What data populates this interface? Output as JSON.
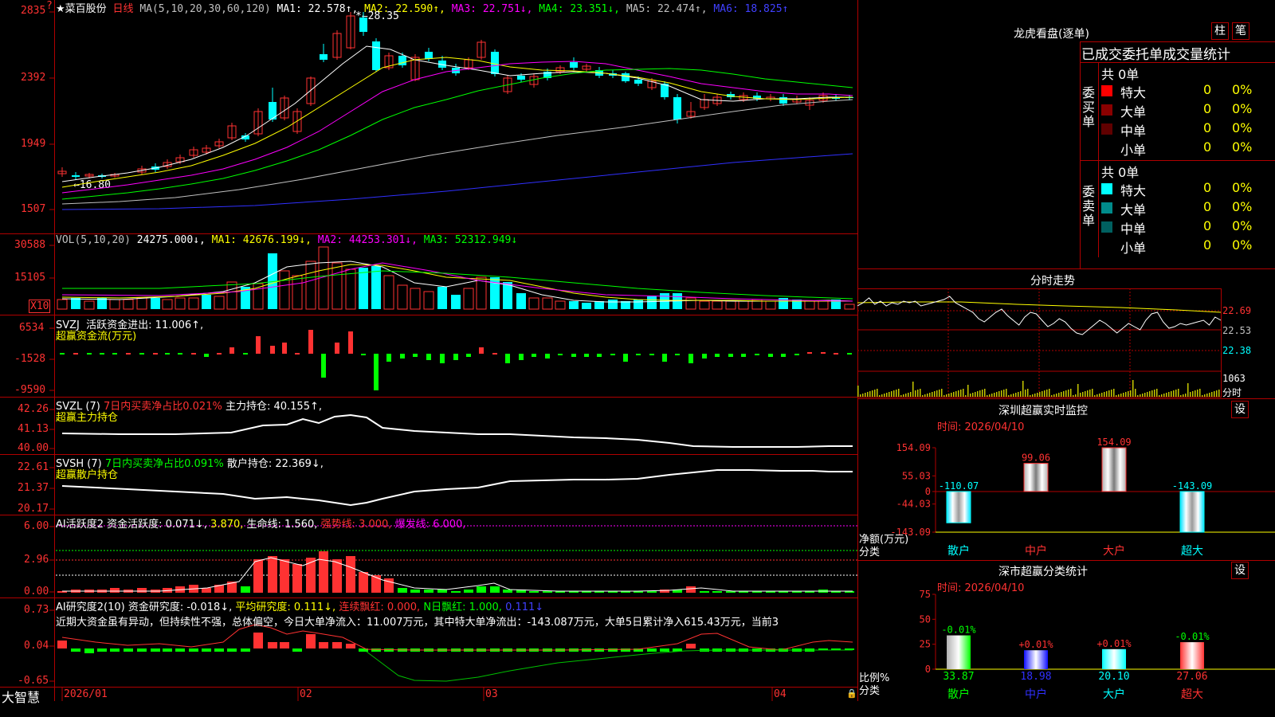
{
  "colors": {
    "up": "#ff3232",
    "down": "#00ffff",
    "ma1": "#ffffff",
    "ma2": "#ffff00",
    "ma3": "#ff00ff",
    "ma4": "#00ff00",
    "ma5": "#c0c0c0",
    "ma6": "#3030ff",
    "grid": "#b00000"
  },
  "header": {
    "stock_name": "★菜百股份",
    "period": "日线",
    "ma_title": "MA(5,10,20,30,60,120)",
    "ma1": "MA1: 22.578↑,",
    "ma2": "MA2: 22.590↑,",
    "ma3": "MA3: 22.751↓,",
    "ma4": "MA4: 23.351↓,",
    "ma5": "MA5: 22.474↑,",
    "ma6": "MA6: 18.825↑"
  },
  "price_axis": [
    "2835",
    "2392",
    "1949",
    "1507"
  ],
  "price_annotations": {
    "high": "28.35",
    "low": "16.80"
  },
  "vol": {
    "title": "VOL(5,10,20)",
    "value": "24275.000↓,",
    "ma1": "MA1: 42676.199↓,",
    "ma2": "MA2: 44253.301↓,",
    "ma3": "MA3: 52312.949↓",
    "axis": [
      "30588",
      "15105"
    ],
    "unit": "X10"
  },
  "svzj": {
    "title": "SVZJ",
    "line1": "活跃资金进出: 11.006↑,",
    "line2": "超赢资金流(万元)",
    "axis": [
      "6534",
      "-1528",
      "-9590"
    ]
  },
  "svzl": {
    "title": "SVZL (7)",
    "ratio": "7日内买卖净占比0.021%",
    "hold": "主力持仓: 40.155↑,",
    "line2": "超赢主力持仓",
    "axis": [
      "42.26",
      "41.13",
      "40.00"
    ]
  },
  "svsh": {
    "title": "SVSH (7)",
    "ratio": "7日内买卖净占比0.091%",
    "hold": "散户持仓: 22.369↓,",
    "line2": "超赢散户持仓",
    "axis": [
      "22.61",
      "21.37",
      "20.17"
    ]
  },
  "ai_active": {
    "title": "AI活跃度2",
    "v1": "资金活跃度: 0.071↓,",
    "v2": "3.870,",
    "v3": "生命线: 1.560,",
    "v4": "强势线: 3.000,",
    "v5": "爆发线: 6.000,",
    "axis": [
      "6.00",
      "2.96",
      "0.00"
    ]
  },
  "ai_research": {
    "title": "AI研究度2(10)",
    "v1": "资金研究度: -0.018↓,",
    "v2": "平均研究度: 0.111↓,",
    "v3": "连续飘红: 0.000,",
    "v4": "N日飘红: 1.000,",
    "v5": "0.111↓",
    "comment": "近期大资金虽有异动，但持续性不强，总体偏空，今日大单净流入：11.007万元，其中特大单净流出：-143.087万元，大单5日累计净入615.43万元，当前3",
    "axis": [
      "0.73",
      "0.04",
      "-0.65"
    ]
  },
  "bottom": {
    "brand": "大智慧",
    "dates": [
      "2026/01",
      "02",
      "03",
      "04"
    ]
  },
  "dragon_tiger": {
    "title": "龙虎看盘(逐单)",
    "btn1": "柱",
    "btn2": "笔",
    "subtitle": "已成交委托单成交量统计",
    "buy_label": "委买单",
    "sell_label": "委卖单",
    "buy_total": "共 0单",
    "sell_total": "共 0单",
    "buy_rows": [
      {
        "name": "特大",
        "count": "0",
        "pct": "0%"
      },
      {
        "name": "大单",
        "count": "0",
        "pct": "0%"
      },
      {
        "name": "中单",
        "count": "0",
        "pct": "0%"
      },
      {
        "name": "小单",
        "count": "0",
        "pct": "0%"
      }
    ],
    "sell_rows": [
      {
        "name": "特大",
        "count": "0",
        "pct": "0%"
      },
      {
        "name": "大单",
        "count": "0",
        "pct": "0%"
      },
      {
        "name": "中单",
        "count": "0",
        "pct": "0%"
      },
      {
        "name": "小单",
        "count": "0",
        "pct": "0%"
      }
    ]
  },
  "intraday": {
    "title": "分时走势",
    "axis": [
      "22.69",
      "22.53",
      "22.38"
    ],
    "vol_value": "1063",
    "vol_unit": "分时"
  },
  "sz_monitor": {
    "title": "深圳超赢实时监控",
    "btn": "设",
    "time": "时间: 2026/04/10",
    "axis": [
      "154.09",
      "55.03",
      "0",
      "-44.03",
      "-143.09"
    ],
    "ylabel": "净额(万元)",
    "xlabel": "分类",
    "bars": [
      {
        "name": "散户",
        "value": -110.07,
        "label": "-110.07"
      },
      {
        "name": "中户",
        "value": 99.06,
        "label": "99.06"
      },
      {
        "name": "大户",
        "value": 154.09,
        "label": "154.09"
      },
      {
        "name": "超大",
        "value": -143.09,
        "label": "-143.09"
      }
    ]
  },
  "sz_class": {
    "title": "深市超赢分类统计",
    "btn": "设",
    "time": "时间: 2026/04/10",
    "axis": [
      "75",
      "50",
      "25",
      "0"
    ],
    "ylabel": "比例%",
    "xlabel": "分类",
    "bars": [
      {
        "name": "散户",
        "value": 33.87,
        "label": "33.87",
        "delta": "-0.01%"
      },
      {
        "name": "中户",
        "value": 18.98,
        "label": "18.98",
        "delta": "+0.01%"
      },
      {
        "name": "大户",
        "value": 20.1,
        "label": "20.10",
        "delta": "+0.01%"
      },
      {
        "name": "超大",
        "value": 27.06,
        "label": "27.06",
        "delta": "-0.01%"
      }
    ]
  }
}
